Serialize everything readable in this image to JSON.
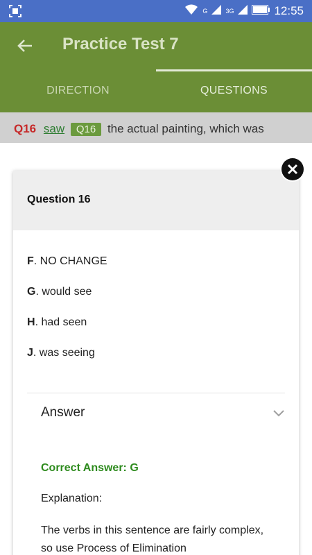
{
  "status_bar": {
    "time": "12:55",
    "icons": [
      "screenshot-icon",
      "wifi-icon",
      "signal-icon",
      "signal-3g-icon",
      "battery-icon"
    ],
    "network_label_1": "G",
    "network_label_2": "3G"
  },
  "app_bar": {
    "title": "Practice Test 7",
    "back_icon": "arrow-left-icon"
  },
  "tabs": [
    {
      "label": "DIRECTION",
      "active": false
    },
    {
      "label": "QUESTIONS",
      "active": true
    }
  ],
  "passage": {
    "number": "Q16",
    "underlined_text": "saw",
    "chip_label": "Q16",
    "rest_text": "the actual painting, which was"
  },
  "card": {
    "header": "Question 16",
    "options": [
      {
        "letter": "F",
        "text": ". NO CHANGE"
      },
      {
        "letter": "G",
        "text": ". would see"
      },
      {
        "letter": "H",
        "text": ". had seen"
      },
      {
        "letter": "J",
        "text": ". was seeing"
      }
    ],
    "answer_label": "Answer",
    "correct_answer": "Correct Answer: G",
    "explanation_label": "Explanation:",
    "explanation_text": "The verbs in this sentence are fairly complex, so use Process of Elimination"
  },
  "colors": {
    "status_bar": "#4a6fc6",
    "app_bar": "#6b8e36",
    "correct_green": "#2e8b1e",
    "question_red": "#c62828"
  }
}
